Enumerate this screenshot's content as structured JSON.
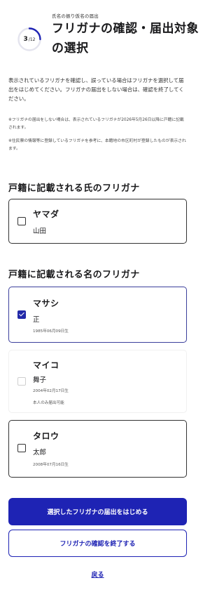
{
  "header": {
    "kicker": "氏名の振り仮名の届出",
    "step_current": "3",
    "step_total": "/12",
    "title": "フリガナの確認・届出対象の選択"
  },
  "intro": {
    "text": "表示されているフリガナを確認し、誤っている場合はフリガナを選択して届出をはじめてください。フリガナの届出をしない場合は、確認を終了してください。",
    "note1": "※フリガナの届出をしない場合は、表示されているフリガナが2026年5月26日以降に戸籍に記載されます。",
    "note2": "※住民票の情報等に登録しているフリガナを参考に、本籍地の市区町村が登録したものが表示されます。"
  },
  "surname_section": {
    "heading": "戸籍に記載される氏のフリガナ",
    "card": {
      "kana": "ヤマダ",
      "kanji": "山田",
      "checked": false
    }
  },
  "given_section": {
    "heading": "戸籍に記載される名のフリガナ",
    "cards": [
      {
        "kana": "マサシ",
        "kanji": "正",
        "birth": "1985年06月09日生",
        "checked": true
      },
      {
        "kana": "マイコ",
        "kanji": "舞子",
        "birth": "2004年02月17日生",
        "note": "本人のみ届出可能",
        "checked": false,
        "disabled": true
      },
      {
        "kana": "タロウ",
        "kanji": "太郎",
        "birth": "2008年07月16日生",
        "checked": false
      }
    ]
  },
  "actions": {
    "primary": "選択したフリガナの届出をはじめる",
    "secondary": "フリガナの確認を終了する",
    "back": "戻る"
  },
  "colors": {
    "accent": "#1e23b4",
    "selected_border": "#3b3f9c",
    "text": "#1a1a1c"
  },
  "progress_fraction": 0.25
}
